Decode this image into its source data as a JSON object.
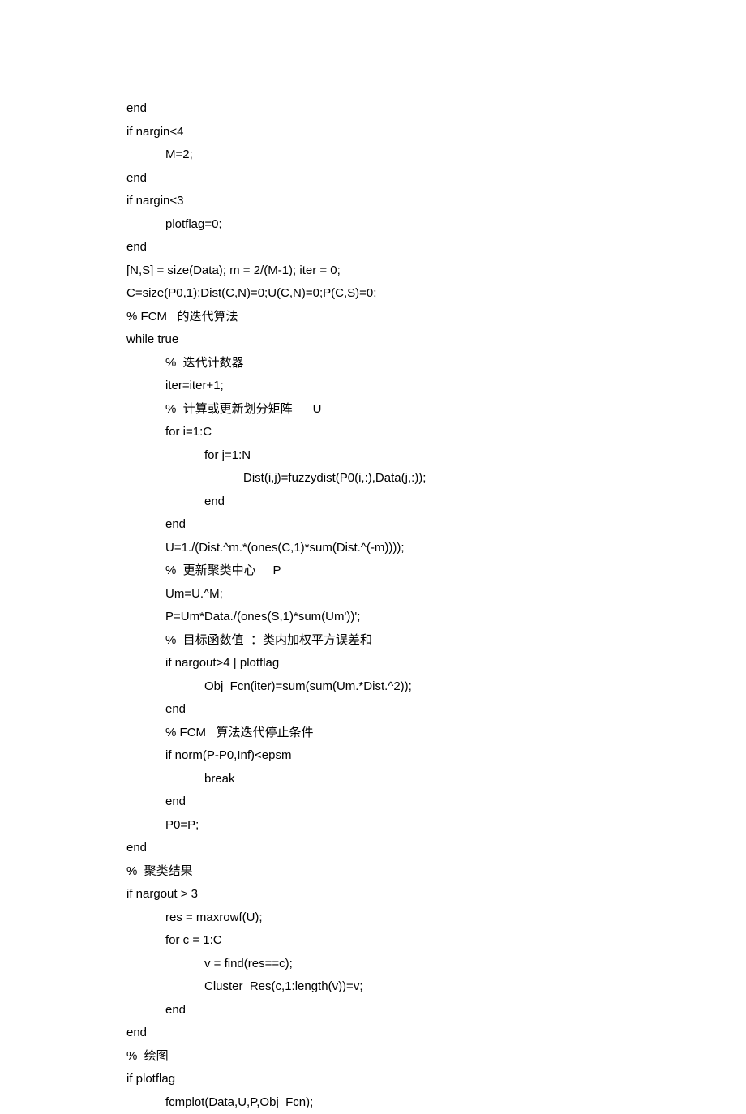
{
  "lines": [
    {
      "indent": 0,
      "text": "end"
    },
    {
      "indent": 0,
      "text": "if nargin<4"
    },
    {
      "indent": 1,
      "text": "M=2;"
    },
    {
      "indent": 0,
      "text": "end"
    },
    {
      "indent": 0,
      "text": "if nargin<3"
    },
    {
      "indent": 1,
      "text": "plotflag=0;"
    },
    {
      "indent": 0,
      "text": "end"
    },
    {
      "indent": 0,
      "text": "[N,S] = size(Data); m = 2/(M-1); iter = 0;"
    },
    {
      "indent": 0,
      "text": "C=size(P0,1);Dist(C,N)=0;U(C,N)=0;P(C,S)=0;"
    },
    {
      "indent": 0,
      "text": "% FCM   的迭代算法"
    },
    {
      "indent": 0,
      "text": "while true"
    },
    {
      "indent": 1,
      "text": "%  迭代计数器"
    },
    {
      "indent": 1,
      "text": "iter=iter+1;"
    },
    {
      "indent": 1,
      "text": "%  计算或更新划分矩阵      U"
    },
    {
      "indent": 1,
      "text": "for i=1:C"
    },
    {
      "indent": 2,
      "text": "for j=1:N"
    },
    {
      "indent": 3,
      "text": "Dist(i,j)=fuzzydist(P0(i,:),Data(j,:));"
    },
    {
      "indent": 2,
      "text": "end"
    },
    {
      "indent": 1,
      "text": "end"
    },
    {
      "indent": 1,
      "text": "U=1./(Dist.^m.*(ones(C,1)*sum(Dist.^(-m))));"
    },
    {
      "indent": 1,
      "text": "%  更新聚类中心     P"
    },
    {
      "indent": 1,
      "text": "Um=U.^M;"
    },
    {
      "indent": 1,
      "text": "P=Um*Data./(ones(S,1)*sum(Um'))';"
    },
    {
      "indent": 1,
      "text": "%  目标函数值  ：类内加权平方误差和"
    },
    {
      "indent": 1,
      "text": "if nargout>4 | plotflag"
    },
    {
      "indent": 2,
      "text": "Obj_Fcn(iter)=sum(sum(Um.*Dist.^2));"
    },
    {
      "indent": 1,
      "text": "end"
    },
    {
      "indent": 1,
      "text": "% FCM   算法迭代停止条件"
    },
    {
      "indent": 1,
      "text": "if norm(P-P0,Inf)<epsm"
    },
    {
      "indent": 2,
      "text": "break"
    },
    {
      "indent": 1,
      "text": "end"
    },
    {
      "indent": 1,
      "text": "P0=P;"
    },
    {
      "indent": 0,
      "text": "end"
    },
    {
      "indent": 0,
      "text": "%  聚类结果"
    },
    {
      "indent": 0,
      "text": "if nargout > 3"
    },
    {
      "indent": 1,
      "text": "res = maxrowf(U);"
    },
    {
      "indent": 1,
      "text": "for c = 1:C"
    },
    {
      "indent": 2,
      "text": "v = find(res==c);"
    },
    {
      "indent": 2,
      "text": "Cluster_Res(c,1:length(v))=v;"
    },
    {
      "indent": 1,
      "text": "end"
    },
    {
      "indent": 0,
      "text": "end"
    },
    {
      "indent": 0,
      "text": "%  绘图"
    },
    {
      "indent": 0,
      "text": "if plotflag"
    },
    {
      "indent": 1,
      "text": "fcmplot(Data,U,P,Obj_Fcn);"
    }
  ]
}
